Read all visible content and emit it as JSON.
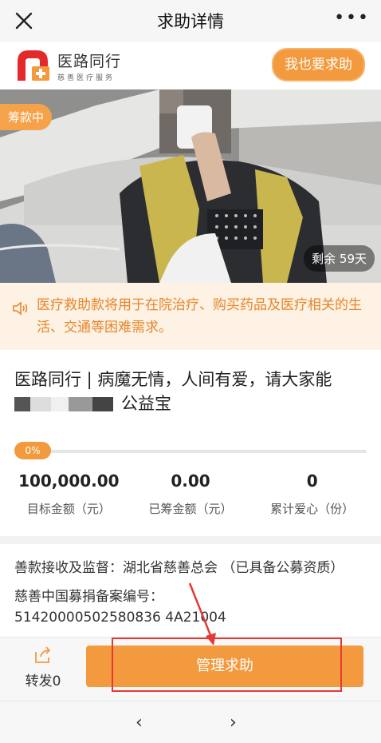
{
  "nav": {
    "title": "求助详情",
    "close_icon": "close-icon",
    "more_icon": "more-icon"
  },
  "brand": {
    "name": "医路同行",
    "subtitle": "慈善医疗服务",
    "help_button": "我也要求助"
  },
  "photo": {
    "status_badge": "筹款中",
    "remaining": "剩余 59天"
  },
  "notice": {
    "text": "医疗救助款将用于在院治疗、购买药品及医疗相关的生活、交通等困难需求。"
  },
  "headline": {
    "line1": "医路同行 | 病魔无情，人间有爱，请大家能",
    "line2_suffix": "公益宝"
  },
  "progress": {
    "percent_label": "0%",
    "value": 0
  },
  "stats": [
    {
      "value": "100,000.00",
      "label": "目标金额（元）"
    },
    {
      "value": "0.00",
      "label": "已筹金额（元）"
    },
    {
      "value": "0",
      "label": "累计爱心（份）"
    }
  ],
  "info": {
    "supervisor": "善款接收及监督：湖北省慈善总会 （已具备公募资质）",
    "record_label": "慈善中国募捐备案编号：",
    "record_partial": "51420000502580836 4A21004"
  },
  "bottom": {
    "share_label": "转发0",
    "manage_button": "管理求助"
  },
  "browser": {
    "back": "‹",
    "forward": "›"
  },
  "colors": {
    "accent": "#f39a3e",
    "notice_bg": "#fdf2e3",
    "notice_text": "#e8852c",
    "highlight": "#e53935"
  }
}
